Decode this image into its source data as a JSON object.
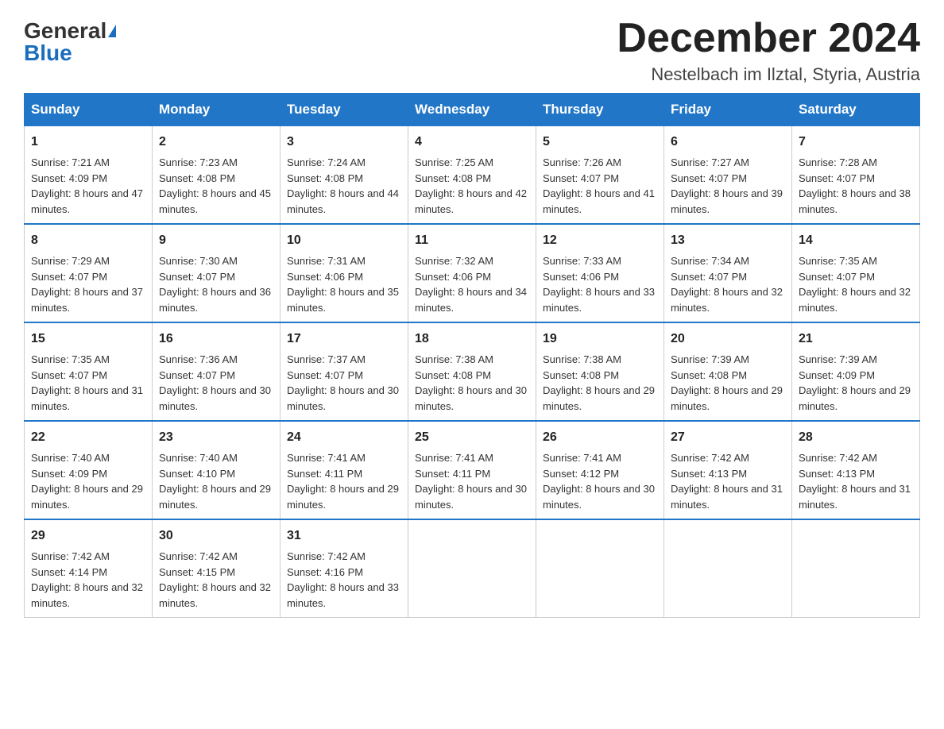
{
  "header": {
    "logo_general": "General",
    "logo_blue": "Blue",
    "month_title": "December 2024",
    "location": "Nestelbach im Ilztal, Styria, Austria"
  },
  "weekdays": [
    "Sunday",
    "Monday",
    "Tuesday",
    "Wednesday",
    "Thursday",
    "Friday",
    "Saturday"
  ],
  "weeks": [
    [
      {
        "day": "1",
        "sunrise": "7:21 AM",
        "sunset": "4:09 PM",
        "daylight": "8 hours and 47 minutes."
      },
      {
        "day": "2",
        "sunrise": "7:23 AM",
        "sunset": "4:08 PM",
        "daylight": "8 hours and 45 minutes."
      },
      {
        "day": "3",
        "sunrise": "7:24 AM",
        "sunset": "4:08 PM",
        "daylight": "8 hours and 44 minutes."
      },
      {
        "day": "4",
        "sunrise": "7:25 AM",
        "sunset": "4:08 PM",
        "daylight": "8 hours and 42 minutes."
      },
      {
        "day": "5",
        "sunrise": "7:26 AM",
        "sunset": "4:07 PM",
        "daylight": "8 hours and 41 minutes."
      },
      {
        "day": "6",
        "sunrise": "7:27 AM",
        "sunset": "4:07 PM",
        "daylight": "8 hours and 39 minutes."
      },
      {
        "day": "7",
        "sunrise": "7:28 AM",
        "sunset": "4:07 PM",
        "daylight": "8 hours and 38 minutes."
      }
    ],
    [
      {
        "day": "8",
        "sunrise": "7:29 AM",
        "sunset": "4:07 PM",
        "daylight": "8 hours and 37 minutes."
      },
      {
        "day": "9",
        "sunrise": "7:30 AM",
        "sunset": "4:07 PM",
        "daylight": "8 hours and 36 minutes."
      },
      {
        "day": "10",
        "sunrise": "7:31 AM",
        "sunset": "4:06 PM",
        "daylight": "8 hours and 35 minutes."
      },
      {
        "day": "11",
        "sunrise": "7:32 AM",
        "sunset": "4:06 PM",
        "daylight": "8 hours and 34 minutes."
      },
      {
        "day": "12",
        "sunrise": "7:33 AM",
        "sunset": "4:06 PM",
        "daylight": "8 hours and 33 minutes."
      },
      {
        "day": "13",
        "sunrise": "7:34 AM",
        "sunset": "4:07 PM",
        "daylight": "8 hours and 32 minutes."
      },
      {
        "day": "14",
        "sunrise": "7:35 AM",
        "sunset": "4:07 PM",
        "daylight": "8 hours and 32 minutes."
      }
    ],
    [
      {
        "day": "15",
        "sunrise": "7:35 AM",
        "sunset": "4:07 PM",
        "daylight": "8 hours and 31 minutes."
      },
      {
        "day": "16",
        "sunrise": "7:36 AM",
        "sunset": "4:07 PM",
        "daylight": "8 hours and 30 minutes."
      },
      {
        "day": "17",
        "sunrise": "7:37 AM",
        "sunset": "4:07 PM",
        "daylight": "8 hours and 30 minutes."
      },
      {
        "day": "18",
        "sunrise": "7:38 AM",
        "sunset": "4:08 PM",
        "daylight": "8 hours and 30 minutes."
      },
      {
        "day": "19",
        "sunrise": "7:38 AM",
        "sunset": "4:08 PM",
        "daylight": "8 hours and 29 minutes."
      },
      {
        "day": "20",
        "sunrise": "7:39 AM",
        "sunset": "4:08 PM",
        "daylight": "8 hours and 29 minutes."
      },
      {
        "day": "21",
        "sunrise": "7:39 AM",
        "sunset": "4:09 PM",
        "daylight": "8 hours and 29 minutes."
      }
    ],
    [
      {
        "day": "22",
        "sunrise": "7:40 AM",
        "sunset": "4:09 PM",
        "daylight": "8 hours and 29 minutes."
      },
      {
        "day": "23",
        "sunrise": "7:40 AM",
        "sunset": "4:10 PM",
        "daylight": "8 hours and 29 minutes."
      },
      {
        "day": "24",
        "sunrise": "7:41 AM",
        "sunset": "4:11 PM",
        "daylight": "8 hours and 29 minutes."
      },
      {
        "day": "25",
        "sunrise": "7:41 AM",
        "sunset": "4:11 PM",
        "daylight": "8 hours and 30 minutes."
      },
      {
        "day": "26",
        "sunrise": "7:41 AM",
        "sunset": "4:12 PM",
        "daylight": "8 hours and 30 minutes."
      },
      {
        "day": "27",
        "sunrise": "7:42 AM",
        "sunset": "4:13 PM",
        "daylight": "8 hours and 31 minutes."
      },
      {
        "day": "28",
        "sunrise": "7:42 AM",
        "sunset": "4:13 PM",
        "daylight": "8 hours and 31 minutes."
      }
    ],
    [
      {
        "day": "29",
        "sunrise": "7:42 AM",
        "sunset": "4:14 PM",
        "daylight": "8 hours and 32 minutes."
      },
      {
        "day": "30",
        "sunrise": "7:42 AM",
        "sunset": "4:15 PM",
        "daylight": "8 hours and 32 minutes."
      },
      {
        "day": "31",
        "sunrise": "7:42 AM",
        "sunset": "4:16 PM",
        "daylight": "8 hours and 33 minutes."
      },
      null,
      null,
      null,
      null
    ]
  ]
}
